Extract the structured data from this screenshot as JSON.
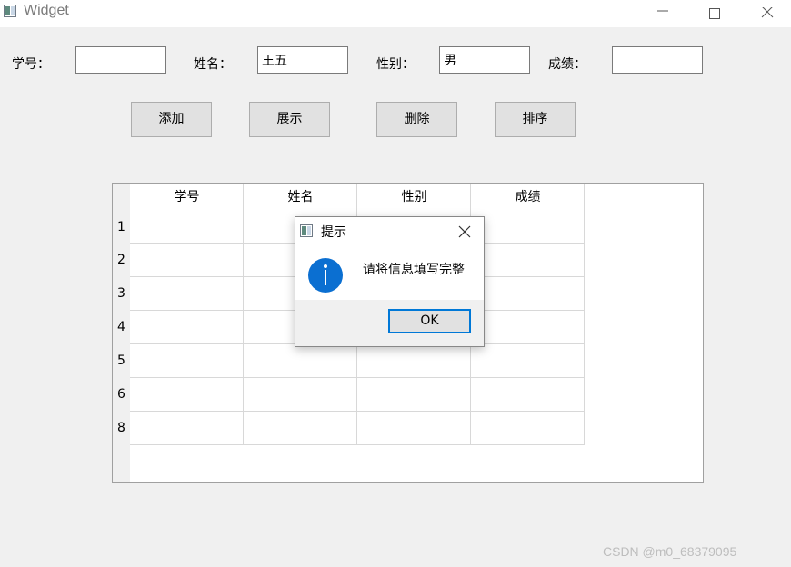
{
  "window": {
    "title": "Widget",
    "icons": {
      "app": "app-window-icon",
      "minimize": "minimize-icon",
      "maximize": "maximize-icon",
      "close": "close-icon"
    }
  },
  "form": {
    "id_label": "学号：",
    "id_value": "",
    "name_label": "姓名：",
    "name_value": "王五",
    "gender_label": "性别：",
    "gender_value": "男",
    "score_label": "成绩：",
    "score_value": ""
  },
  "buttons": {
    "add": "添加",
    "show": "展示",
    "delete": "删除",
    "sort": "排序"
  },
  "table": {
    "columns": [
      "学号",
      "姓名",
      "性别",
      "成绩"
    ],
    "row_labels": [
      "1",
      "2",
      "3",
      "4",
      "5",
      "6",
      "8"
    ]
  },
  "dialog": {
    "title": "提示",
    "message": "请将信息填写完整",
    "ok_label": "OK",
    "icon": "info-icon"
  },
  "watermark": "CSDN @m0_68379095"
}
